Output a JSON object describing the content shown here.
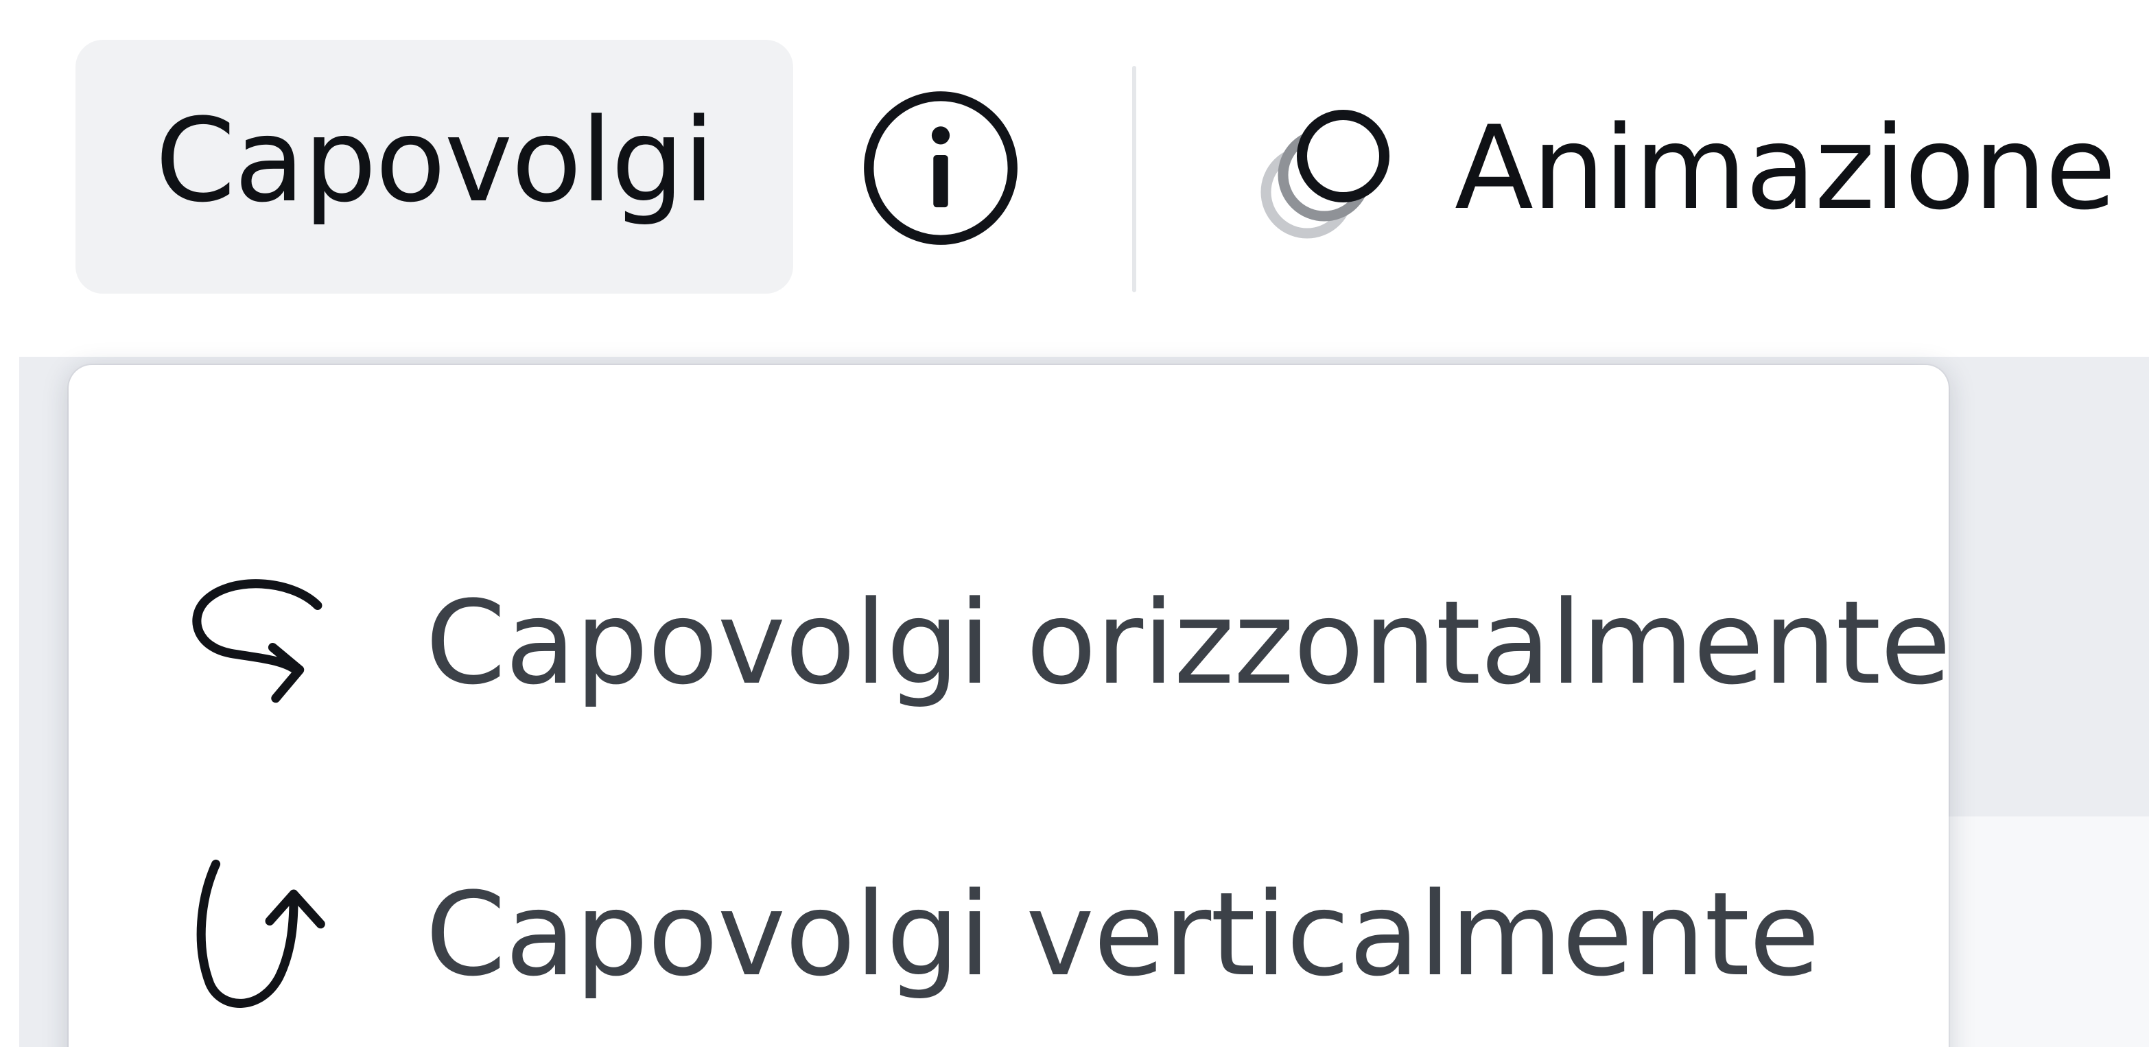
{
  "toolbar": {
    "flip_label": "Capovolgi",
    "animation_label": "Animazione"
  },
  "icons": {
    "info": "info-icon",
    "animation": "animation-icon",
    "flip_horizontal": "flip-horizontal-icon",
    "flip_vertical": "flip-vertical-icon"
  },
  "menu": {
    "items": [
      {
        "label": "Capovolgi orizzontalmente",
        "icon": "flip-horizontal-icon"
      },
      {
        "label": "Capovolgi verticalmente",
        "icon": "flip-vertical-icon"
      }
    ]
  },
  "colors": {
    "text_primary": "#0f1115",
    "text_menu": "#3c4148",
    "button_bg": "#f1f2f4",
    "workspace_bg": "#ebedf1"
  }
}
